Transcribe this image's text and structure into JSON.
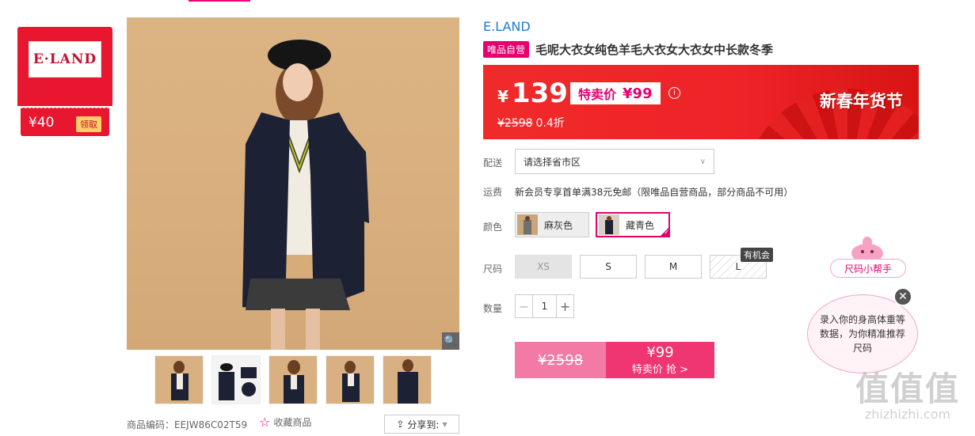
{
  "brand_badge": {
    "logo_text": "E·LAND",
    "coupon_value": "¥40",
    "coupon_action": "领取"
  },
  "thumbnails": [
    "thumb-1",
    "thumb-2",
    "thumb-3",
    "thumb-4",
    "thumb-5"
  ],
  "product_code": "商品编码：EEJW86C02T59",
  "favorite_label": "收藏商品",
  "share_label": "分享到:",
  "brand_name": "E.LAND",
  "self_operated_tag": "唯品自营",
  "product_title": "毛呢大衣女纯色羊毛大衣女大衣女中长款冬季",
  "price": {
    "currency": "¥",
    "current": "139",
    "special_label": "特卖价",
    "special_price": "¥99",
    "original": "¥2598",
    "discount": "0.4折",
    "festival_text": "新春年货节"
  },
  "delivery": {
    "label": "配送",
    "placeholder": "请选择省市区"
  },
  "shipping": {
    "label": "运费",
    "text": "新会员专享首单满38元免邮（限唯品自营商品，部分商品不可用）"
  },
  "colors": {
    "label": "颜色",
    "options": [
      "麻灰色",
      "藏青色"
    ],
    "selected": "藏青色"
  },
  "sizes": {
    "label": "尺码",
    "options": [
      "XS",
      "S",
      "M",
      "L"
    ],
    "chance_tag": "有机会"
  },
  "quantity": {
    "label": "数量",
    "value": "1",
    "minus": "−",
    "plus": "+"
  },
  "buy": {
    "original_price": "¥2598",
    "price": "¥99",
    "action": "特卖价 抢 >"
  },
  "size_helper": {
    "title": "尺码小帮手",
    "message": "录入你的身高体重等数据，为你精准推荐尺码"
  },
  "watermark": {
    "big": "值值值",
    "small": "zhizhizhi.com"
  }
}
